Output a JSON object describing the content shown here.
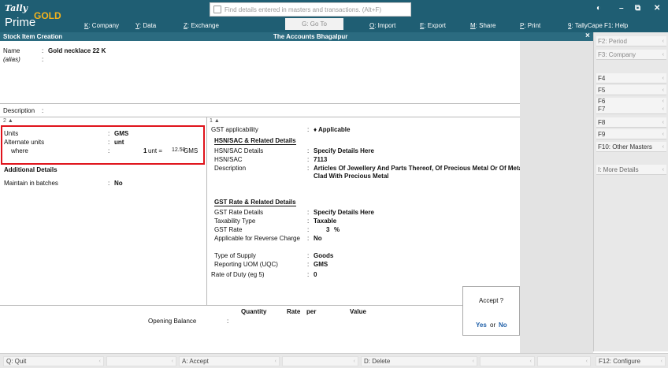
{
  "app": {
    "logo_tally": "Tally",
    "logo_gold": "GOLD",
    "logo_prime": "Prime",
    "search_placeholder": "Find details entered in masters and transactions. (Alt+F)",
    "goto_label": "G: Go To"
  },
  "menu": [
    {
      "key": "K",
      "label": ": Company"
    },
    {
      "key": "Y",
      "label": ": Data"
    },
    {
      "key": "Z",
      "label": ": Exchange"
    },
    {
      "key": "O",
      "label": ": Import"
    },
    {
      "key": "E",
      "label": ": Export"
    },
    {
      "key": "M",
      "label": ": Share"
    },
    {
      "key": "P",
      "label": ": Print"
    },
    {
      "key": "9",
      "label": ": TallyCape"
    },
    {
      "key": "F1",
      "label": ": Help"
    }
  ],
  "titlebar": {
    "left": "Stock Item Creation",
    "center": "The Accounts Bhagalpur",
    "close": "×"
  },
  "form": {
    "name_label": "Name",
    "name_value": "Gold necklace 22 K",
    "alias_label": "(alias)",
    "description_label": "Description",
    "colon": ":",
    "left_section_num": "2 ▲",
    "right_section_num": "1 ▲",
    "units_label": "Units",
    "units_value": "GMS",
    "alt_units_label": "Alternate units",
    "alt_units_value": "unt",
    "where_label": "where",
    "where_qty": "1",
    "where_unit": "unt  =",
    "where_conv_value": "12.50",
    "where_conv_unit": "GMS",
    "additional_details": "Additional Details",
    "maintain_batches_label": "Maintain in batches",
    "maintain_batches_value": "No",
    "gst_applicability_label": "GST applicability",
    "gst_applicability_value": "♦ Applicable",
    "hsn_heading": "HSN/SAC & Related Details",
    "hsn_details_label": "HSN/SAC Details",
    "hsn_details_value": "Specify Details Here",
    "hsn_label": "HSN/SAC",
    "hsn_value": "7113",
    "desc_label": "Description",
    "desc_value_line1": "Articles Of Jewellery And Parts Thereof, Of Precious Metal Or Of Metal",
    "desc_value_line2": "Clad With Precious Metal",
    "gst_rate_heading": "GST Rate & Related Details",
    "gst_rate_details_label": "GST Rate Details",
    "gst_rate_details_value": "Specify Details Here",
    "taxability_label": "Taxability Type",
    "taxability_value": "Taxable",
    "gst_rate_label": "GST Rate",
    "gst_rate_value": "3",
    "gst_rate_unit": "%",
    "reverse_charge_label": "Applicable for Reverse Charge",
    "reverse_charge_value": "No",
    "supply_type_label": "Type of Supply",
    "supply_type_value": "Goods",
    "uqc_label": "Reporting UOM (UQC)",
    "uqc_value": "GMS",
    "rate_of_duty_label": "Rate of Duty (eg 5)",
    "rate_of_duty_value": "0",
    "ob_headers": {
      "quantity": "Quantity",
      "rate": "Rate",
      "per": "per",
      "value": "Value"
    },
    "opening_balance_label": "Opening Balance"
  },
  "accept_dialog": {
    "title": "Accept ?",
    "yes": "Yes",
    "or": "or",
    "no": "No"
  },
  "right_panel": [
    {
      "label": "F2: Period",
      "enabled": false
    },
    {
      "label": "F3: Company",
      "enabled": false
    },
    {
      "label": "F4",
      "enabled": true
    },
    {
      "label": "F5",
      "enabled": true
    },
    {
      "label": "F6",
      "enabled": true
    },
    {
      "label": "F7",
      "enabled": true
    },
    {
      "label": "F8",
      "enabled": true
    },
    {
      "label": "F9",
      "enabled": true
    },
    {
      "label": "F10: Other Masters",
      "enabled": true
    },
    {
      "label": "I: More Details",
      "enabled": false
    }
  ],
  "bottom_bar": [
    {
      "label": "Q: Quit"
    },
    {
      "label": ""
    },
    {
      "label": "A: Accept"
    },
    {
      "label": ""
    },
    {
      "label": "D: Delete"
    },
    {
      "label": ""
    },
    {
      "label": ""
    },
    {
      "label": "F12: Configure"
    }
  ],
  "colors": {
    "topbar": "#1f5e73",
    "titlebar": "#2b6b80",
    "gold": "#f4b31c",
    "highlight": "#e0141c",
    "accept_link": "#1f5fa8"
  }
}
